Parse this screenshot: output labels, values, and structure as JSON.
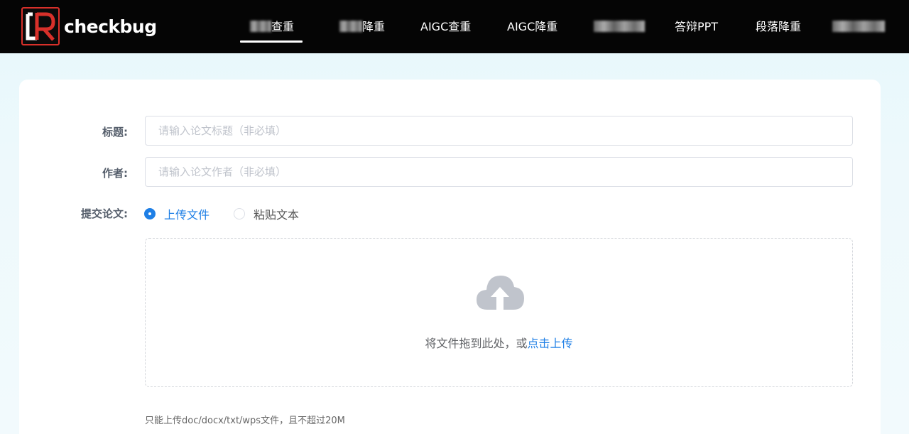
{
  "header": {
    "logo_text": "checkbug",
    "nav": [
      {
        "label": "查重",
        "active": true
      },
      {
        "label": "降重",
        "active": false
      },
      {
        "label": "AIGC查重",
        "active": false
      },
      {
        "label": "AIGC降重",
        "active": false
      },
      {
        "label": "",
        "active": false
      },
      {
        "label": "答辩PPT",
        "active": false
      },
      {
        "label": "段落降重",
        "active": false
      },
      {
        "label": "",
        "active": false
      }
    ]
  },
  "form": {
    "title_label": "标题:",
    "title_placeholder": "请输入论文标题（非必填）",
    "author_label": "作者:",
    "author_placeholder": "请输入论文作者（非必填）",
    "submit_label": "提交论文:",
    "options": [
      {
        "label": "上传文件",
        "checked": true
      },
      {
        "label": "粘贴文本",
        "checked": false
      }
    ]
  },
  "upload": {
    "icon": "cloud-upload-icon",
    "text": "将文件拖到此处，或",
    "link": "点击上传",
    "tip": "只能上传doc/docx/txt/wps文件，且不超过20M"
  },
  "colors": {
    "accent": "#1e7fe6",
    "header_bg": "#050505",
    "logo_red": "#d8302a"
  }
}
